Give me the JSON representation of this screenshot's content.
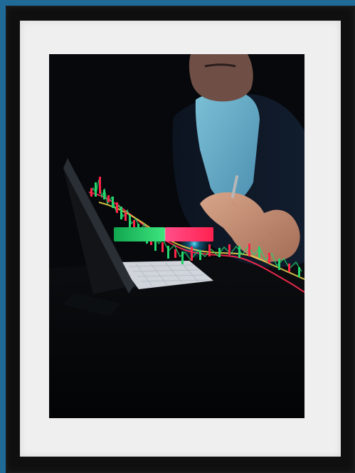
{
  "photo": {
    "subject": "framed-trading-photo",
    "signal_bar": {
      "left_color": "#20c463",
      "right_color": "#ff2a6d",
      "left_text": "",
      "right_text": ""
    }
  },
  "colors": {
    "background": "#1f6a96",
    "frame": "#0f0f0f",
    "mat": "#efefef"
  }
}
